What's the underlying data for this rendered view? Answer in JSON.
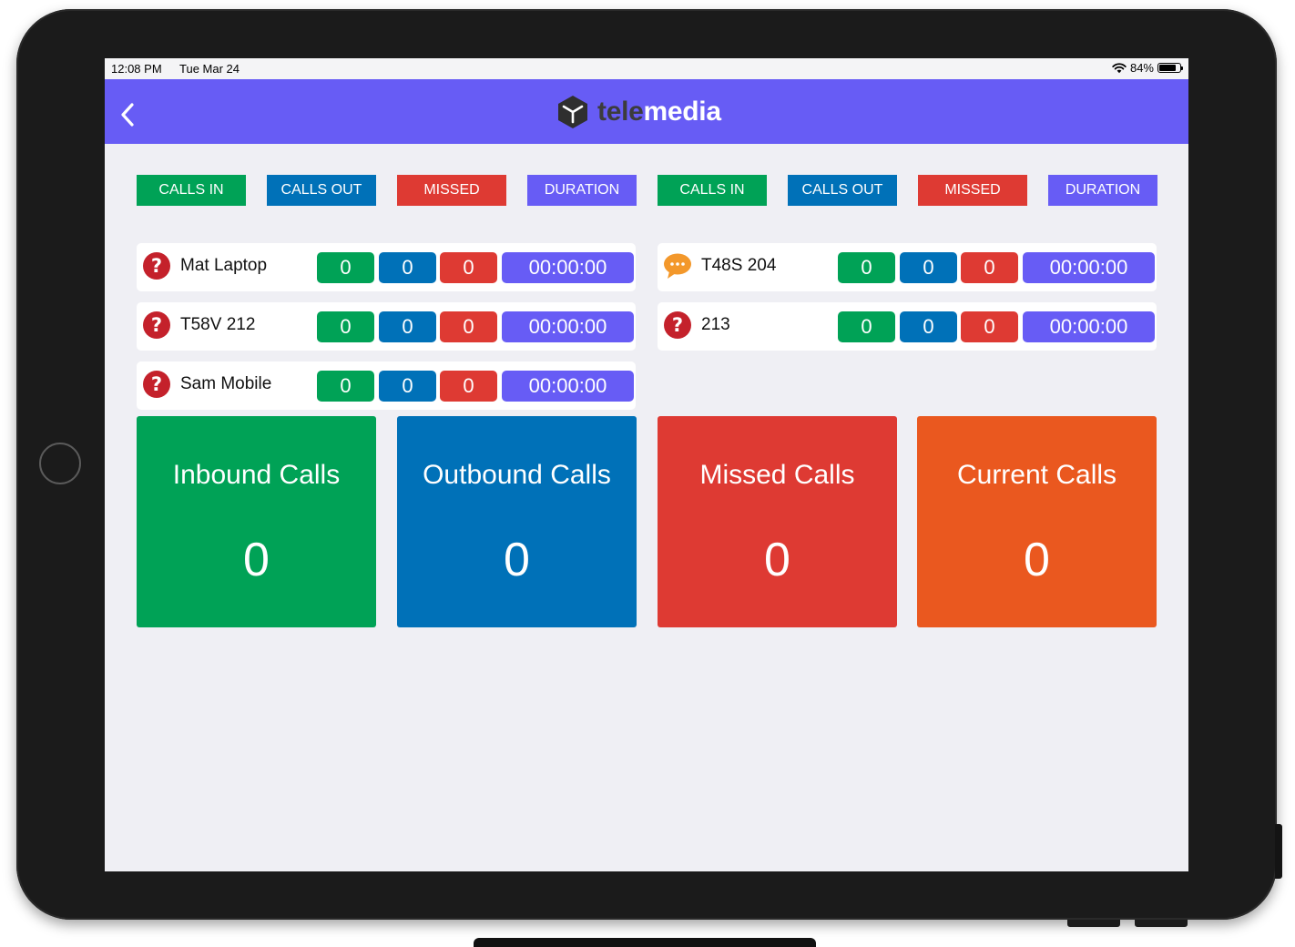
{
  "status_bar": {
    "time": "12:08 PM",
    "date": "Tue Mar 24",
    "battery": "84%",
    "battery_level": 0.84
  },
  "header": {
    "back_icon": "chevron-left-icon",
    "logo": {
      "part1": "tele",
      "part2": "media"
    }
  },
  "column_headers": [
    "CALLS IN",
    "CALLS OUT",
    "MISSED",
    "DURATION"
  ],
  "extensions": [
    {
      "name": "Mat Laptop",
      "icon": "question-circle-icon",
      "calls_in": "0",
      "calls_out": "0",
      "missed": "0",
      "duration": "00:00:00"
    },
    {
      "name": "T58V 212",
      "icon": "question-circle-icon",
      "calls_in": "0",
      "calls_out": "0",
      "missed": "0",
      "duration": "00:00:00"
    },
    {
      "name": "Sam Mobile",
      "icon": "question-circle-icon",
      "calls_in": "0",
      "calls_out": "0",
      "missed": "0",
      "duration": "00:00:00"
    },
    {
      "name": "T48S 204",
      "icon": "chat-bubble-icon",
      "calls_in": "0",
      "calls_out": "0",
      "missed": "0",
      "duration": "00:00:00"
    },
    {
      "name": "213",
      "icon": "question-circle-icon",
      "calls_in": "0",
      "calls_out": "0",
      "missed": "0",
      "duration": "00:00:00"
    }
  ],
  "summary": [
    {
      "title": "Inbound Calls",
      "value": "0"
    },
    {
      "title": "Outbound Calls",
      "value": "0"
    },
    {
      "title": "Missed Calls",
      "value": "0"
    },
    {
      "title": "Current Calls",
      "value": "0"
    }
  ],
  "colors": {
    "nav": "#675cf5",
    "calls_in": "#00a256",
    "calls_out": "#0071b8",
    "missed": "#de3a33",
    "duration": "#675cf5",
    "current": "#ea581f",
    "unknown_status": "#c4212b",
    "chat_status": "#f3982b"
  }
}
